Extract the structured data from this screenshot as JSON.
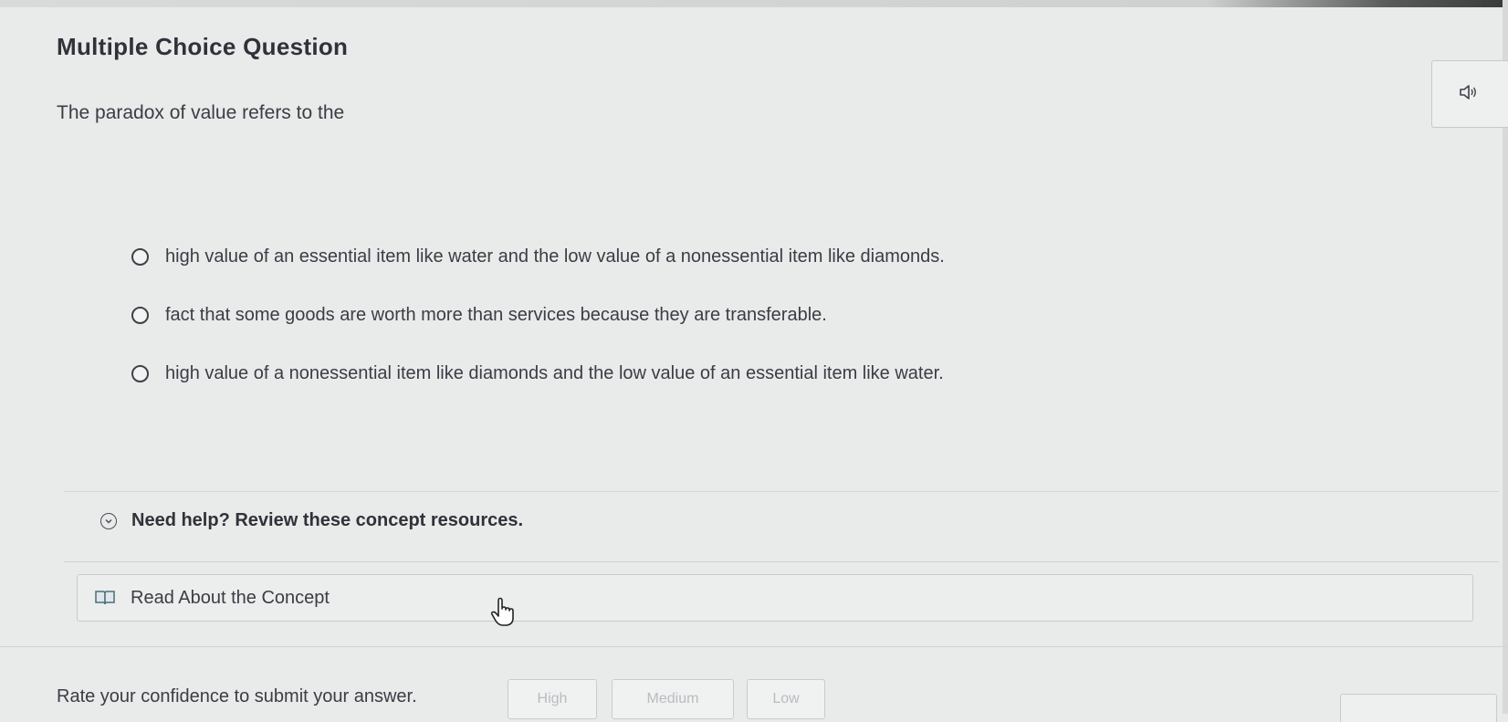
{
  "question": {
    "title": "Multiple Choice Question",
    "prompt": "The paradox of value refers to the"
  },
  "options": [
    {
      "label": "high value of an essential item like water and the low value of a nonessential item like diamonds.",
      "selected": false
    },
    {
      "label": "fact that some goods are worth more than services because they are transferable.",
      "selected": false
    },
    {
      "label": "high value of a nonessential item like diamonds and the low value of an essential item like water.",
      "selected": false
    }
  ],
  "help": {
    "header": "Need help? Review these concept resources.",
    "resource_label": "Read About the Concept"
  },
  "confidence": {
    "label": "Rate your confidence to submit your answer.",
    "high": "High",
    "medium": "Medium",
    "low": "Low"
  },
  "icons": {
    "audio": "speaker-icon",
    "chevron": "chevron-down-icon",
    "book": "book-icon",
    "cursor": "hand-pointer-icon"
  }
}
